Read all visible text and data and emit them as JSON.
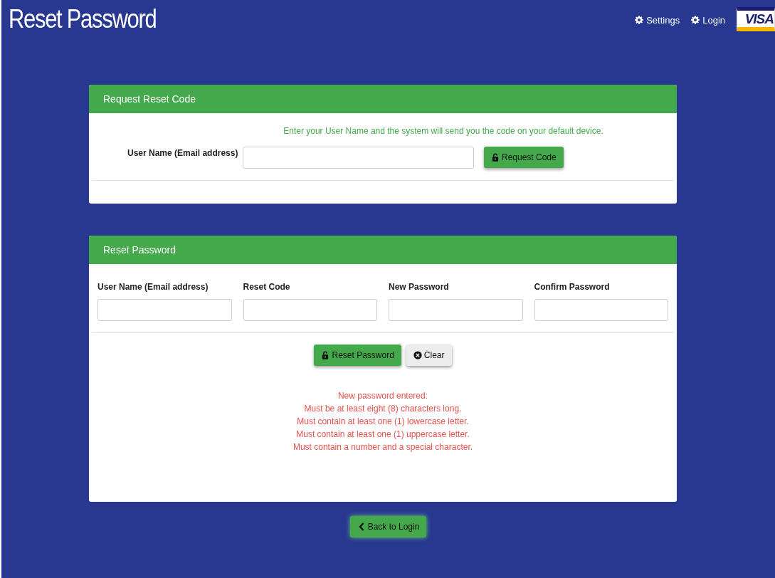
{
  "header": {
    "title": "Reset Password",
    "nav": [
      {
        "label": "Settings"
      },
      {
        "label": "Login"
      }
    ],
    "logo": "VISA"
  },
  "request_card": {
    "title": "Request Reset Code",
    "hint": "Enter your User Name and the system will send you the code on your default device.",
    "field_label": "User Name (Email address)",
    "button": "Request Code"
  },
  "reset_card": {
    "title": "Reset Password",
    "fields": [
      {
        "label": "User Name (Email address)"
      },
      {
        "label": "Reset Code"
      },
      {
        "label": "New Password"
      },
      {
        "label": "Confirm Password"
      }
    ],
    "buttons": [
      {
        "kind": "primary",
        "label": "Reset Password"
      },
      {
        "kind": "clear",
        "label": "Clear"
      }
    ],
    "messages": [
      "New password entered:",
      "Must be at least eight (8) characters long.",
      "Must contain at least one (1) lowercase letter.",
      "Must contain at least one (1) uppercase letter.",
      "Must contain a number and a special character."
    ]
  },
  "back_button": "Back to Login"
}
